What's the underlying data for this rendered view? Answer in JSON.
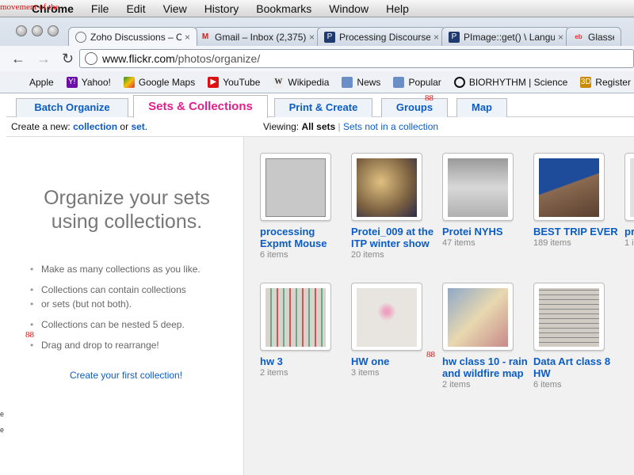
{
  "menubar": {
    "overlay_text": "movement of the",
    "items": [
      "Chrome",
      "File",
      "Edit",
      "View",
      "History",
      "Bookmarks",
      "Window",
      "Help"
    ]
  },
  "tabs": [
    {
      "label": "Zoho Discussions – C",
      "icon": "globe-icon",
      "color": "#7a8aa0"
    },
    {
      "label": "Gmail – Inbox (2,375)",
      "icon": "gmail-icon",
      "color": "#cc2222"
    },
    {
      "label": "Processing Discourse",
      "icon": "processing-icon",
      "color": "#1e3a6e"
    },
    {
      "label": "PImage::get() \\ Langu",
      "icon": "processing-icon",
      "color": "#1e3a6e"
    },
    {
      "label": "Glasses",
      "icon": "ebay-icon",
      "color": "#e53238"
    }
  ],
  "omnibox": {
    "host": "www.flickr.com",
    "path": "/photos/organize/"
  },
  "bookmarks": [
    {
      "label": "Apple",
      "icon": "apple-icon",
      "color": "#555"
    },
    {
      "label": "Yahoo!",
      "icon": "yahoo-icon",
      "color": "#6b0ea8"
    },
    {
      "label": "Google Maps",
      "icon": "maps-icon",
      "color": "#2a8d2a"
    },
    {
      "label": "YouTube",
      "icon": "youtube-icon",
      "color": "#d11"
    },
    {
      "label": "Wikipedia",
      "icon": "wikipedia-icon",
      "color": "#333"
    },
    {
      "label": "News",
      "icon": "folder-icon",
      "color": "#6a8fc7"
    },
    {
      "label": "Popular",
      "icon": "folder-icon",
      "color": "#6a8fc7"
    },
    {
      "label": "BIORHYTHM | Science",
      "icon": "biorhythm-icon",
      "color": "#111"
    },
    {
      "label": "Register",
      "icon": "3d-icon",
      "color": "#c98a00"
    }
  ],
  "flickr_tabs": [
    "Batch Organize",
    "Sets & Collections",
    "Print & Create",
    "Groups",
    "Map"
  ],
  "marker_88": "88",
  "subbar": {
    "create_prefix": "Create a new:",
    "collection": "collection",
    "or": "or",
    "set": "set",
    "period": ".",
    "viewing_prefix": "Viewing:",
    "all_sets": "All sets",
    "sep": "|",
    "not_in_collection": "Sets not in a collection"
  },
  "left": {
    "title_line1": "Organize your sets",
    "title_line2": "using collections.",
    "bullets": [
      "Make as many collections as you like.",
      "Collections can contain collections",
      "or sets (but not both).",
      "Collections can be nested 5 deep.",
      "Drag and drop to rearrange!"
    ],
    "create_link": "Create your first collection!"
  },
  "sets": [
    {
      "title": "processing Expmt Mouse",
      "count": "6 items",
      "color": "#c8c8c8"
    },
    {
      "title": "Protei_009 at the ITP winter show",
      "count": "20 items",
      "color": "#7a6040"
    },
    {
      "title": "Protei NYHS",
      "count": "47 items",
      "color": "#b0b0b0"
    },
    {
      "title": "BEST TRIP EVER",
      "count": "189 items",
      "color": "#3d5f8a"
    },
    {
      "title": "pr",
      "count": "1 i",
      "color": "#e0e0e0"
    },
    {
      "title": "hw 3",
      "count": "2 items",
      "color": "#d8d4cc"
    },
    {
      "title": "HW one",
      "count": "3 items",
      "color": "#e8e4e0"
    },
    {
      "title": "hw class 10 - rain and wildfire map",
      "count": "2 items",
      "color": "#8fa8c8"
    },
    {
      "title": "Data Art class 8 HW",
      "count": "6 items",
      "color": "#d0ccc4"
    }
  ],
  "left_edge": [
    "e",
    "e"
  ]
}
